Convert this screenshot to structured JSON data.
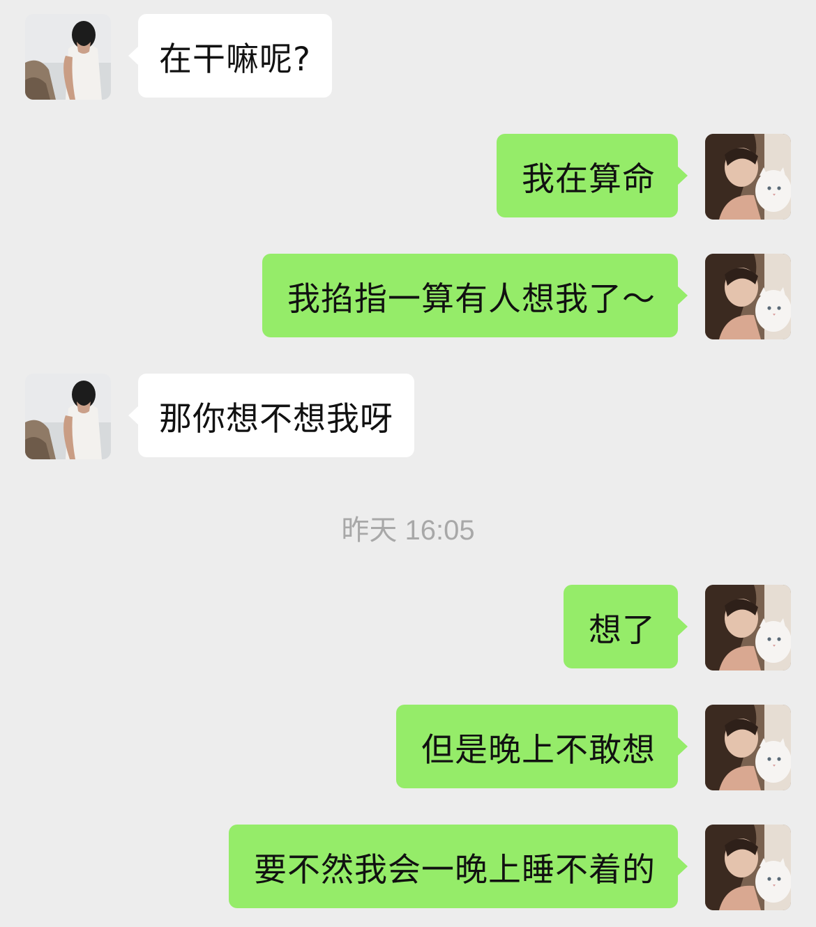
{
  "messages": [
    {
      "side": "in",
      "text": "在干嘛呢?"
    },
    {
      "side": "out",
      "text": "我在算命"
    },
    {
      "side": "out",
      "text": "我掐指一算有人想我了～"
    },
    {
      "side": "in",
      "text": "那你想不想我呀"
    },
    {
      "side": "out",
      "text": "想了"
    },
    {
      "side": "out",
      "text": "但是晚上不敢想"
    },
    {
      "side": "out",
      "text": "要不然我会一晚上睡不着的"
    }
  ],
  "timestamp": "昨天 16:05",
  "avatars": {
    "contact": "contact-avatar-man-by-sea",
    "self": "self-avatar-woman-with-cat"
  },
  "colors": {
    "background": "#ededed",
    "incoming_bubble": "#ffffff",
    "outgoing_bubble": "#95ec69",
    "timestamp_text": "#a8a8a8"
  }
}
